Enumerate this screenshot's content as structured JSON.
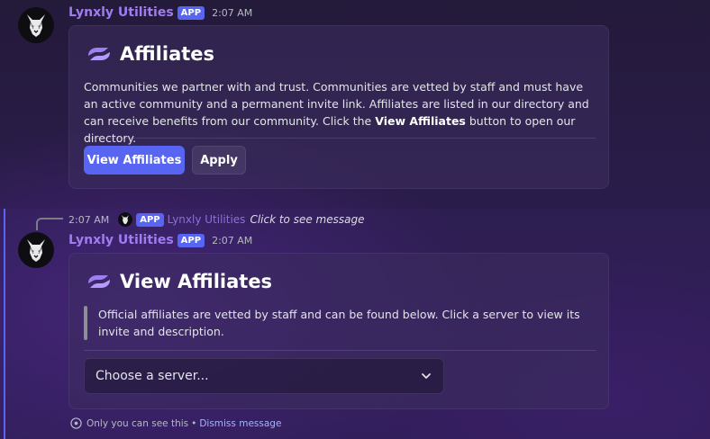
{
  "messages": [
    {
      "author": "Lynxly Utilities",
      "tag": "APP",
      "time": "2:07 AM",
      "embed": {
        "title": "Affiliates",
        "desc_part1": "Communities we partner with and trust. Communities are vetted by staff and must have an active community and a permanent invite link. Affiliates are listed in our directory and can receive benefits from our community. Click the ",
        "desc_bold": "View Affiliates",
        "desc_part2": " button to open our directory.",
        "buttons": [
          {
            "label": "View Affiliates"
          },
          {
            "label": "Apply"
          }
        ]
      }
    },
    {
      "author": "Lynxly Utilities",
      "tag": "APP",
      "time": "2:07 AM",
      "reply": {
        "time": "2:07 AM",
        "tag": "APP",
        "author": "Lynxly Utilities",
        "text": "Click to see message"
      },
      "embed": {
        "title": "View Affiliates",
        "desc": "Official affiliates are vetted by staff and can be found below. Click a server to view its invite and description.",
        "select_placeholder": "Choose a server..."
      },
      "ephemeral": {
        "text": "Only you can see this",
        "separator": "•",
        "dismiss": "Dismiss message"
      }
    }
  ],
  "colors": {
    "accent": "#5865f2",
    "username": "#a07cf0",
    "link": "#a8b4ff"
  }
}
